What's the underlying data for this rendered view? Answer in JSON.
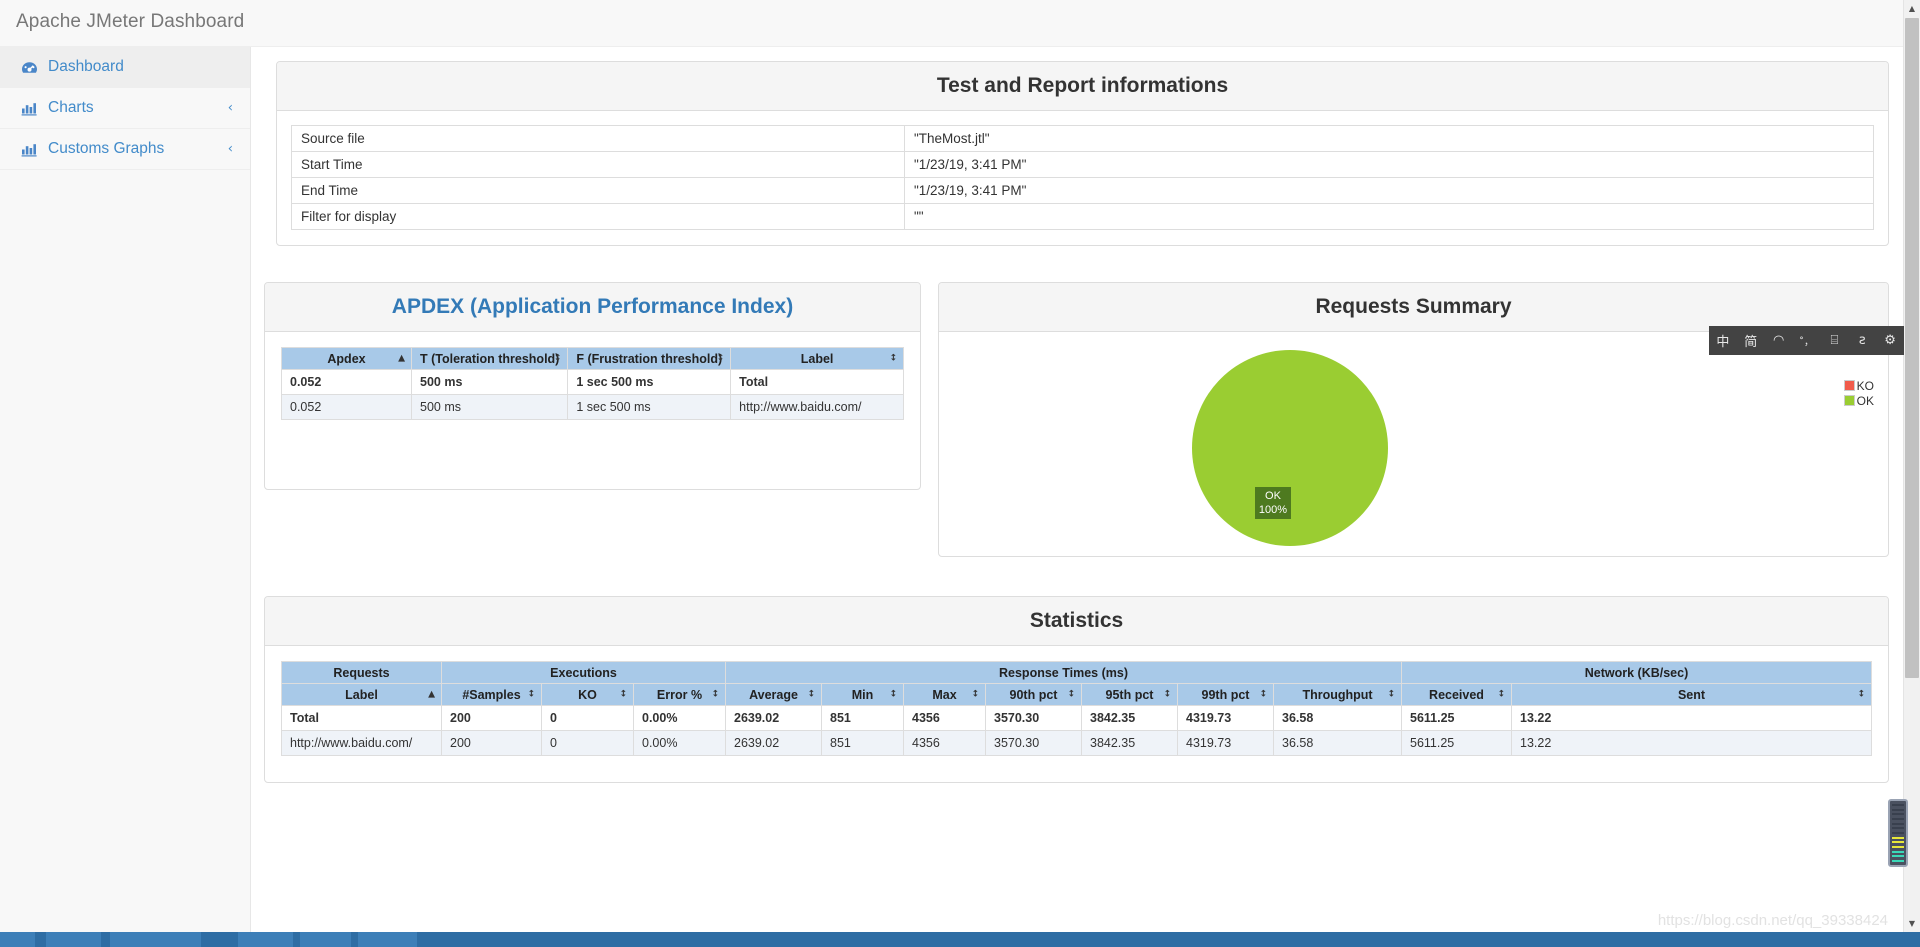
{
  "header": {
    "brand": "Apache JMeter Dashboard"
  },
  "sidebar": {
    "items": [
      {
        "label": "Dashboard",
        "icon": "tachometer-icon",
        "caret": "",
        "active": true
      },
      {
        "label": "Charts",
        "icon": "bar-chart-icon",
        "caret": "‹",
        "active": false
      },
      {
        "label": "Customs Graphs",
        "icon": "bar-chart-icon",
        "caret": "‹",
        "active": false
      }
    ]
  },
  "info_panel": {
    "title": "Test and Report informations",
    "rows": [
      {
        "key": "Source file",
        "value": "\"TheMost.jtl\""
      },
      {
        "key": "Start Time",
        "value": "\"1/23/19, 3:41 PM\""
      },
      {
        "key": "End Time",
        "value": "\"1/23/19, 3:41 PM\""
      },
      {
        "key": "Filter for display",
        "value": "\"\""
      }
    ]
  },
  "apdex_panel": {
    "title": "APDEX (Application Performance Index)",
    "columns": [
      {
        "label": "Apdex",
        "sort": "▲"
      },
      {
        "label": "T (Toleration threshold)",
        "sort": "↕"
      },
      {
        "label": "F (Frustration threshold)",
        "sort": "↕"
      },
      {
        "label": "Label",
        "sort": "↕"
      }
    ],
    "rows": [
      [
        "0.052",
        "500 ms",
        "1 sec 500 ms",
        "Total"
      ],
      [
        "0.052",
        "500 ms",
        "1 sec 500 ms",
        "http://www.baidu.com/"
      ]
    ]
  },
  "requests_panel": {
    "title": "Requests Summary"
  },
  "chart_data": {
    "type": "pie",
    "title": "Requests Summary",
    "categories": [
      "KO",
      "OK"
    ],
    "values": [
      0,
      100
    ],
    "value_unit": "%",
    "colors": {
      "KO": "#f15b4b",
      "OK": "#9acd32"
    },
    "labels": [
      {
        "name": "OK",
        "text_line1": "OK",
        "text_line2": "100%",
        "value": 100
      }
    ],
    "legend": [
      {
        "name": "KO",
        "color": "#f15b4b"
      },
      {
        "name": "OK",
        "color": "#9acd32"
      }
    ],
    "legend_position": "right",
    "grid": false
  },
  "statistics_panel": {
    "title": "Statistics",
    "group_headers": [
      {
        "label": "Requests",
        "span": 1
      },
      {
        "label": "Executions",
        "span": 3
      },
      {
        "label": "Response Times (ms)",
        "span": 7
      },
      {
        "label": "Network (KB/sec)",
        "span": 2
      }
    ],
    "columns": [
      {
        "label": "Label",
        "sort": "▲"
      },
      {
        "label": "#Samples",
        "sort": "↕"
      },
      {
        "label": "KO",
        "sort": "↕"
      },
      {
        "label": "Error %",
        "sort": "↕"
      },
      {
        "label": "Average",
        "sort": "↕"
      },
      {
        "label": "Min",
        "sort": "↕"
      },
      {
        "label": "Max",
        "sort": "↕"
      },
      {
        "label": "90th pct",
        "sort": "↕"
      },
      {
        "label": "95th pct",
        "sort": "↕"
      },
      {
        "label": "99th pct",
        "sort": "↕"
      },
      {
        "label": "Throughput",
        "sort": "↕"
      },
      {
        "label": "Received",
        "sort": "↕"
      },
      {
        "label": "Sent",
        "sort": "↕"
      }
    ],
    "rows": [
      [
        "Total",
        "200",
        "0",
        "0.00%",
        "2639.02",
        "851",
        "4356",
        "3570.30",
        "3842.35",
        "4319.73",
        "36.58",
        "5611.25",
        "13.22"
      ],
      [
        "http://www.baidu.com/",
        "200",
        "0",
        "0.00%",
        "2639.02",
        "851",
        "4356",
        "3570.30",
        "3842.35",
        "4319.73",
        "36.58",
        "5611.25",
        "13.22"
      ]
    ]
  },
  "ime_toolbar": {
    "buttons": [
      {
        "label": "中",
        "name": "ime-chinese-english-toggle"
      },
      {
        "label": "简",
        "name": "ime-simplified-traditional-toggle"
      },
      {
        "label": "◠",
        "name": "ime-theme-icon"
      },
      {
        "label": "˚，",
        "name": "ime-punctuation-icon"
      },
      {
        "label": "⌸",
        "name": "ime-keyboard-icon"
      },
      {
        "label": "ƨ",
        "name": "ime-toolbox-icon"
      },
      {
        "label": "⚙",
        "name": "ime-settings-gear-icon"
      }
    ]
  },
  "scrollbar": {
    "up_arrow": "▲",
    "down_arrow": "▼"
  },
  "watermark": {
    "text": "https://blog.csdn.net/qq_39338424"
  }
}
